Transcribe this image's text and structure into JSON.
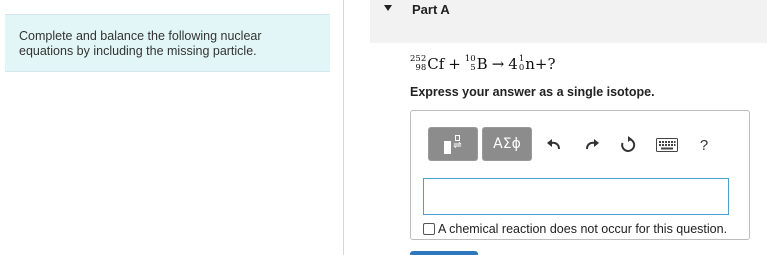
{
  "instructions": {
    "text": "Complete and balance the following nuclear equations by including the missing particle."
  },
  "part": {
    "title": "Part A"
  },
  "equation": {
    "reactant1": {
      "symbol": "Cf",
      "mass": "252",
      "atomic": "98"
    },
    "plus": "+",
    "reactant2": {
      "symbol": "B",
      "mass": "10",
      "atomic": "5"
    },
    "arrow": "→",
    "coefficient": "4",
    "product": {
      "symbol": "n",
      "mass": "1",
      "atomic": "0"
    },
    "plus2": "+",
    "unknown": "?"
  },
  "prompt": "Express your answer as a single isotope.",
  "toolbar": {
    "greek_label": "ΑΣϕ",
    "help_label": "?",
    "icons": [
      "template-icon",
      "greek-letters",
      "undo-icon",
      "redo-icon",
      "reset-icon",
      "keyboard-icon",
      "help-icon"
    ]
  },
  "answer": {
    "value": ""
  },
  "no_reaction": {
    "label": "A chemical reaction does not occur for this question.",
    "checked": false
  }
}
